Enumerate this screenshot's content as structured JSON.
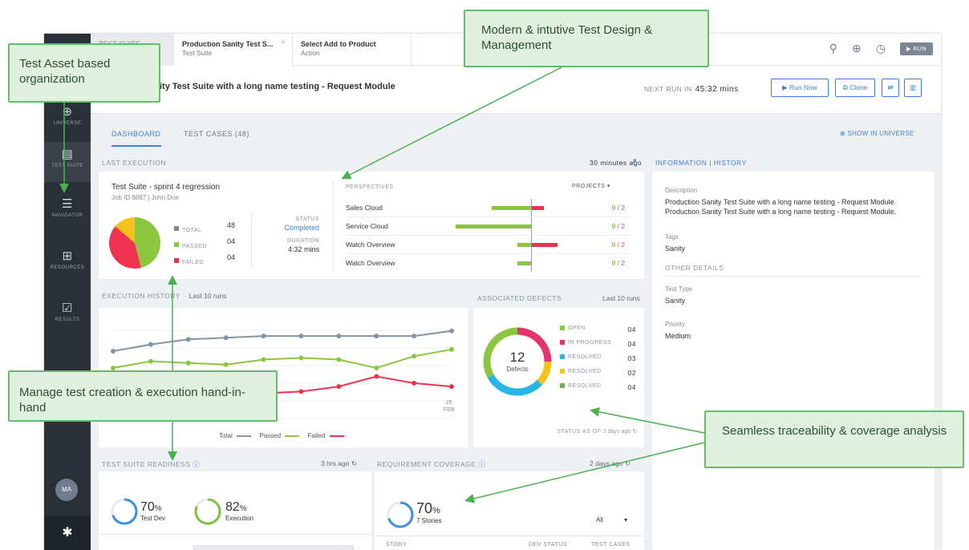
{
  "sidebar": {
    "items": [
      {
        "label": "UNIVERSE",
        "icon": "globe-icon"
      },
      {
        "label": "TEST SUITE",
        "icon": "document-icon"
      },
      {
        "label": "NAVIGATOR",
        "icon": "list-icon"
      },
      {
        "label": "RESOURCES",
        "icon": "grid-icon"
      },
      {
        "label": "RESULTS",
        "icon": "check-icon"
      }
    ],
    "avatar": "MA"
  },
  "tabs": [
    {
      "title": "TEST SUITE",
      "sub": ""
    },
    {
      "title": "Production Sanity Test S...",
      "sub": "Test Suite"
    },
    {
      "title": "Select Add to Product",
      "sub": "Action"
    }
  ],
  "topbar": {
    "run": "▶ RUN"
  },
  "header": {
    "title": "ity Test Suite with a long name testing - Request Module",
    "next_run_label": "NEXT RUN IN",
    "next_run_value": "45:32 mins",
    "run_now": "▶ Run Now",
    "clone": "⧉ Clone"
  },
  "subtabs": {
    "dashboard": "DASHBOARD",
    "test_cases": "TEST CASES (48)",
    "show_universe": "SHOW IN UNIVERSE"
  },
  "last_execution": {
    "title": "LAST EXECUTION",
    "time": "30 minutes ago",
    "suite": "Test Suite - sprint 4 regression",
    "job": "Job ID 8887 | John Doe",
    "stats": [
      {
        "label": "TOTAL",
        "value": "48",
        "color": "#7d8a99"
      },
      {
        "label": "PASSED",
        "value": "04",
        "color": "#8cc63f"
      },
      {
        "label": "FAILED",
        "value": "04",
        "color": "#ee3350"
      }
    ],
    "status_label": "STATUS",
    "status": "Completed",
    "duration_label": "DURATION",
    "duration": "4:32 mins",
    "pie": {
      "values": [
        40,
        35,
        12
      ],
      "colors": [
        "#8cc63f",
        "#ee3350",
        "#f7c21b"
      ]
    },
    "perspectives_title": "PERSPECTIVES",
    "projects": "PROJECTS",
    "perspectives": [
      {
        "name": "Sales Cloud",
        "pass": 9,
        "fail": 2,
        "passw": 50,
        "failw": 15,
        "ratio": "9 / 2"
      },
      {
        "name": "Service Cloud",
        "pass": 9,
        "fail": 2,
        "passw": 95,
        "failw": 0,
        "ratio": "9 / 2"
      },
      {
        "name": "Watch Overview",
        "pass": 9,
        "fail": 2,
        "passw": 18,
        "failw": 32,
        "ratio": "9 / 2"
      },
      {
        "name": "Watch Overview",
        "pass": 9,
        "fail": 2,
        "passw": 18,
        "failw": 0,
        "ratio": "9 / 2"
      }
    ]
  },
  "history": {
    "title": "EXECUTION HISTORY",
    "sub": "Last 10 runs",
    "date_day": "25",
    "date_month": "FEB",
    "legend": [
      "Total",
      "Passed",
      "Failed"
    ]
  },
  "chart_data": {
    "type": "line",
    "x": [
      1,
      2,
      3,
      4,
      5,
      6,
      7,
      8,
      9,
      10
    ],
    "series": [
      {
        "name": "Total",
        "values": [
          40,
          44,
          47,
          48,
          49,
          49,
          49,
          49,
          49,
          52
        ],
        "color": "#8592a3"
      },
      {
        "name": "Passed",
        "values": [
          30,
          34,
          33,
          32,
          35,
          36,
          35,
          30,
          37,
          41
        ],
        "color": "#8cc63f"
      },
      {
        "name": "Failed",
        "values": [
          17,
          16,
          15,
          16,
          15,
          16,
          19,
          25,
          21,
          19
        ],
        "color": "#ee3350"
      }
    ],
    "xlabel": "",
    "ylabel": ""
  },
  "defects": {
    "title": "ASSOCIATED DEFECTS",
    "sub": "Last 10 runs",
    "count": "12",
    "label": "Defects",
    "items": [
      {
        "label": "OPEN",
        "value": "04",
        "color": "#8cc63f"
      },
      {
        "label": "IN PROGRESS",
        "value": "04",
        "color": "#e6336b"
      },
      {
        "label": "RESOLVED",
        "value": "03",
        "color": "#27b5e6"
      },
      {
        "label": "RESOLVED",
        "value": "02",
        "color": "#f7c21b"
      },
      {
        "label": "RESOLVED",
        "value": "04",
        "color": "#6fb24a"
      }
    ],
    "status_as_of": "STATUS AS OF",
    "status_time": "3 days ago",
    "donut": [
      {
        "v": 25,
        "c": "#e6336b"
      },
      {
        "v": 12,
        "c": "#f7c21b"
      },
      {
        "v": 30,
        "c": "#27b5e6"
      },
      {
        "v": 33,
        "c": "#8cc63f"
      }
    ]
  },
  "info": {
    "title": "INFORMATION | HISTORY",
    "desc_label": "Description",
    "desc": "Production Sanity Test Suite with a long name testing - Request Module. Production Sanity Test Suite with a long name testing - Request Module.",
    "tags_label": "Tags",
    "tags": "Sanity",
    "other": "OTHER DETAILS",
    "type_label": "Test Type",
    "type": "Sanity",
    "priority_label": "Priority",
    "priority": "Medium"
  },
  "readiness": {
    "title": "TEST SUITE READINESS",
    "time": "3 hrs ago",
    "a_pct": "70",
    "a_label": "Test Dev",
    "b_pct": "82",
    "b_label": "Execution",
    "a_val": 0.7,
    "b_val": 0.82
  },
  "coverage": {
    "title": "REQUIREMENT COVERAGE",
    "time": "2 days ago",
    "pct": "70",
    "label": "7 Stories",
    "value": 0.7,
    "filter": "All",
    "cols": [
      "STORY",
      "DEV STATUS",
      "TEST CASES"
    ]
  },
  "annotations": {
    "a1": "Test Asset based organization",
    "a2": "Modern & intutive Test Design & Management",
    "a3": "Manage test creation & execution hand-in-hand",
    "a4": "Seamless traceability & coverage analysis"
  }
}
